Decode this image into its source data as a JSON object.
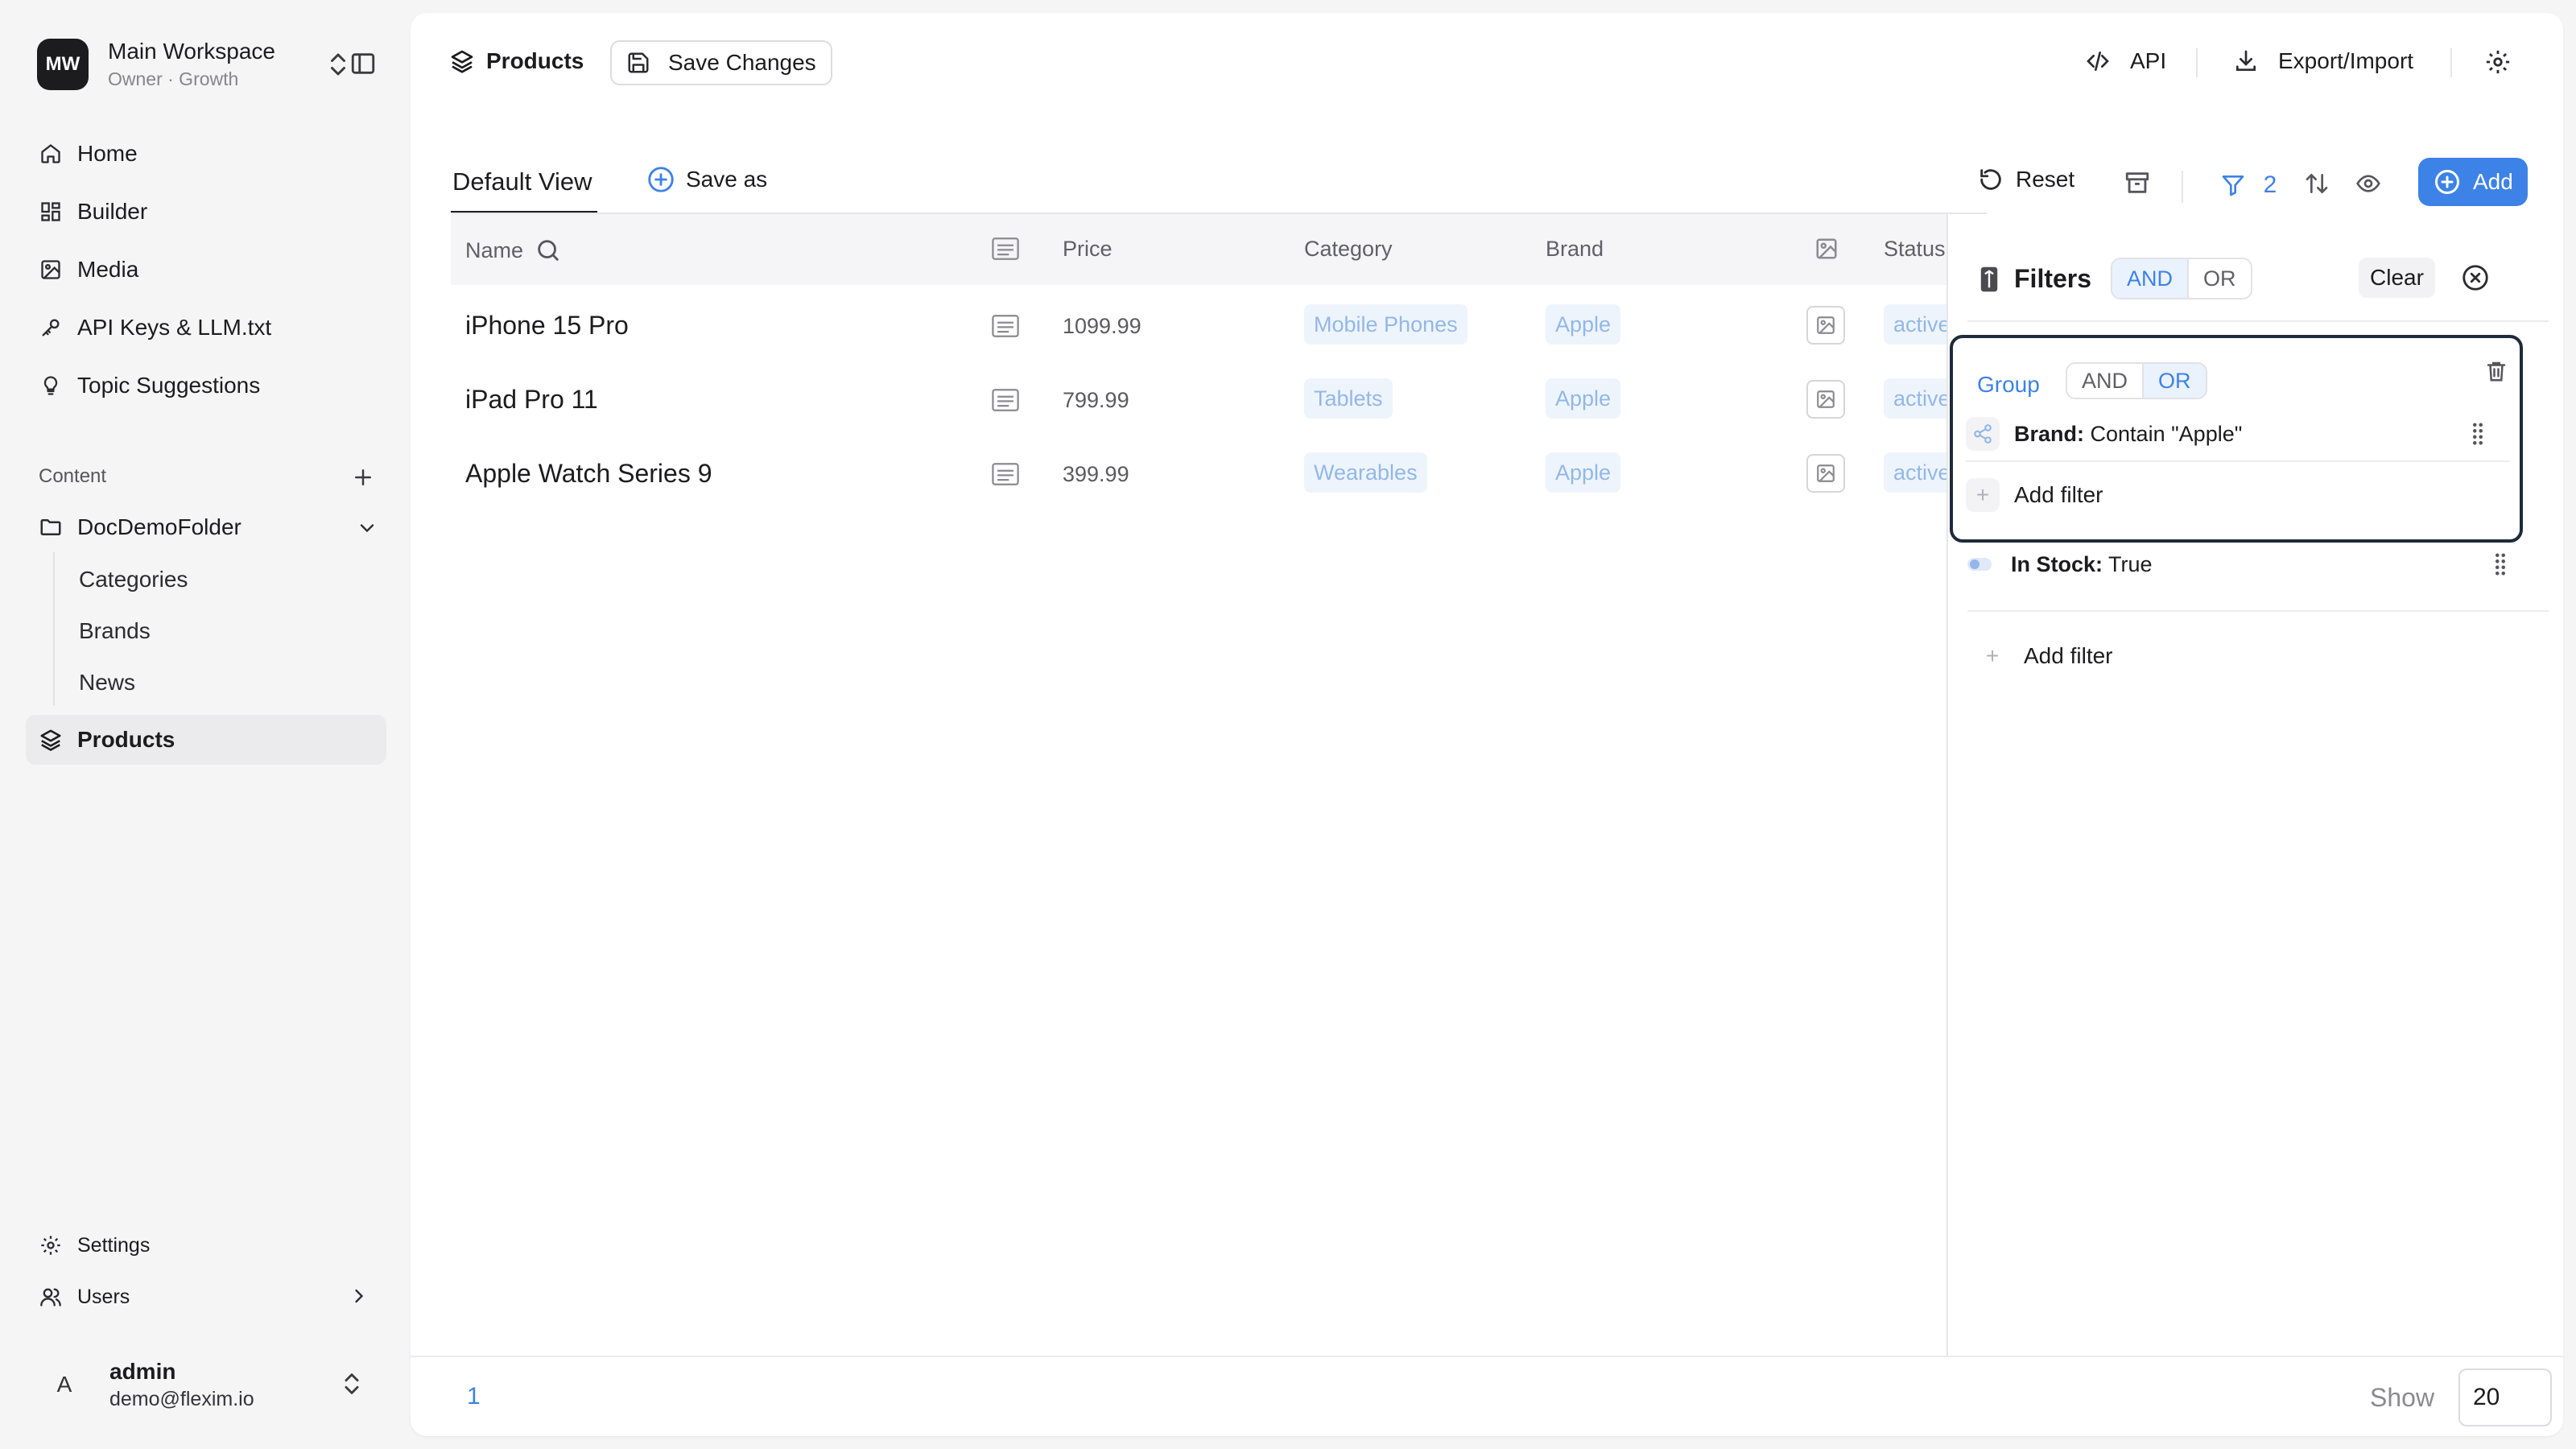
{
  "workspace": {
    "initials": "MW",
    "name": "Main Workspace",
    "subtitle": "Owner · Growth"
  },
  "nav": {
    "home": "Home",
    "builder": "Builder",
    "media": "Media",
    "api_keys": "API Keys & LLM.txt",
    "topics": "Topic Suggestions"
  },
  "content_section": {
    "label": "Content",
    "folder": "DocDemoFolder",
    "children": [
      "Categories",
      "Brands",
      "News"
    ],
    "products": "Products"
  },
  "bottom_nav": {
    "settings": "Settings",
    "users": "Users"
  },
  "user": {
    "initial": "A",
    "name": "admin",
    "email": "demo@flexim.io"
  },
  "topbar": {
    "title": "Products",
    "save": "Save Changes",
    "api": "API",
    "export": "Export/Import"
  },
  "view": {
    "tab": "Default View",
    "save_as": "Save as"
  },
  "toolbar": {
    "reset": "Reset",
    "filter_count": "2",
    "add": "Add"
  },
  "table": {
    "columns": {
      "name": "Name",
      "price": "Price",
      "category": "Category",
      "brand": "Brand",
      "status": "Status"
    },
    "rows": [
      {
        "name": "iPhone 15 Pro",
        "price": "1099.99",
        "category": "Mobile Phones",
        "brand": "Apple",
        "status": "active"
      },
      {
        "name": "iPad Pro 11",
        "price": "799.99",
        "category": "Tablets",
        "brand": "Apple",
        "status": "active"
      },
      {
        "name": "Apple Watch Series 9",
        "price": "399.99",
        "category": "Wearables",
        "brand": "Apple",
        "status": "active"
      }
    ]
  },
  "pagination": {
    "page": "1",
    "show_label": "Show",
    "page_size": "20"
  },
  "filters": {
    "title": "Filters",
    "and": "AND",
    "or": "OR",
    "clear": "Clear",
    "group": {
      "label": "Group",
      "and": "AND",
      "or": "OR",
      "filter_field": "Brand:",
      "filter_value": "Contain \"Apple\"",
      "add_filter": "Add filter"
    },
    "stock_field": "In Stock:",
    "stock_value": "True",
    "add_filter": "Add filter"
  },
  "colors": {
    "accent": "#3d82e6",
    "chip_bg": "#eef4fc",
    "chip_text": "#92b8e8"
  }
}
